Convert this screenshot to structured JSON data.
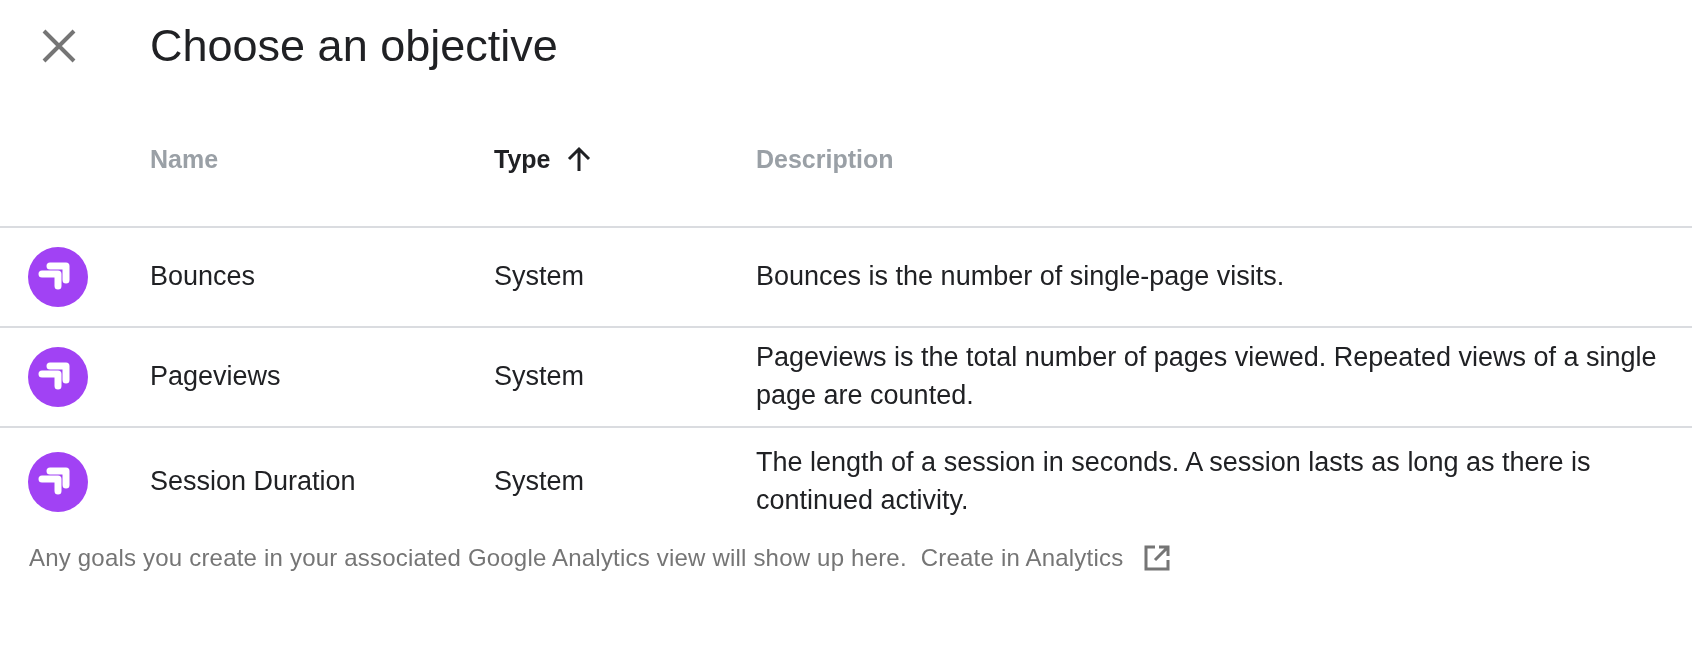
{
  "dialog": {
    "title": "Choose an objective"
  },
  "table": {
    "columns": [
      {
        "label": "Name",
        "sorted": false
      },
      {
        "label": "Type",
        "sorted": true
      },
      {
        "label": "Description",
        "sorted": false
      }
    ],
    "rows": [
      {
        "name": "Bounces",
        "type": "System",
        "description": "Bounces is the number of single-page visits."
      },
      {
        "name": "Pageviews",
        "type": "System",
        "description": "Pageviews is the total number of pages viewed. Repeated views of a single page are counted."
      },
      {
        "name": "Session Duration",
        "type": "System",
        "description": "The length of a session in seconds. A session lasts as long as there is continued activity."
      }
    ]
  },
  "footer": {
    "text": "Any goals you create in your associated Google Analytics view will show up here.",
    "link": "Create in Analytics"
  }
}
